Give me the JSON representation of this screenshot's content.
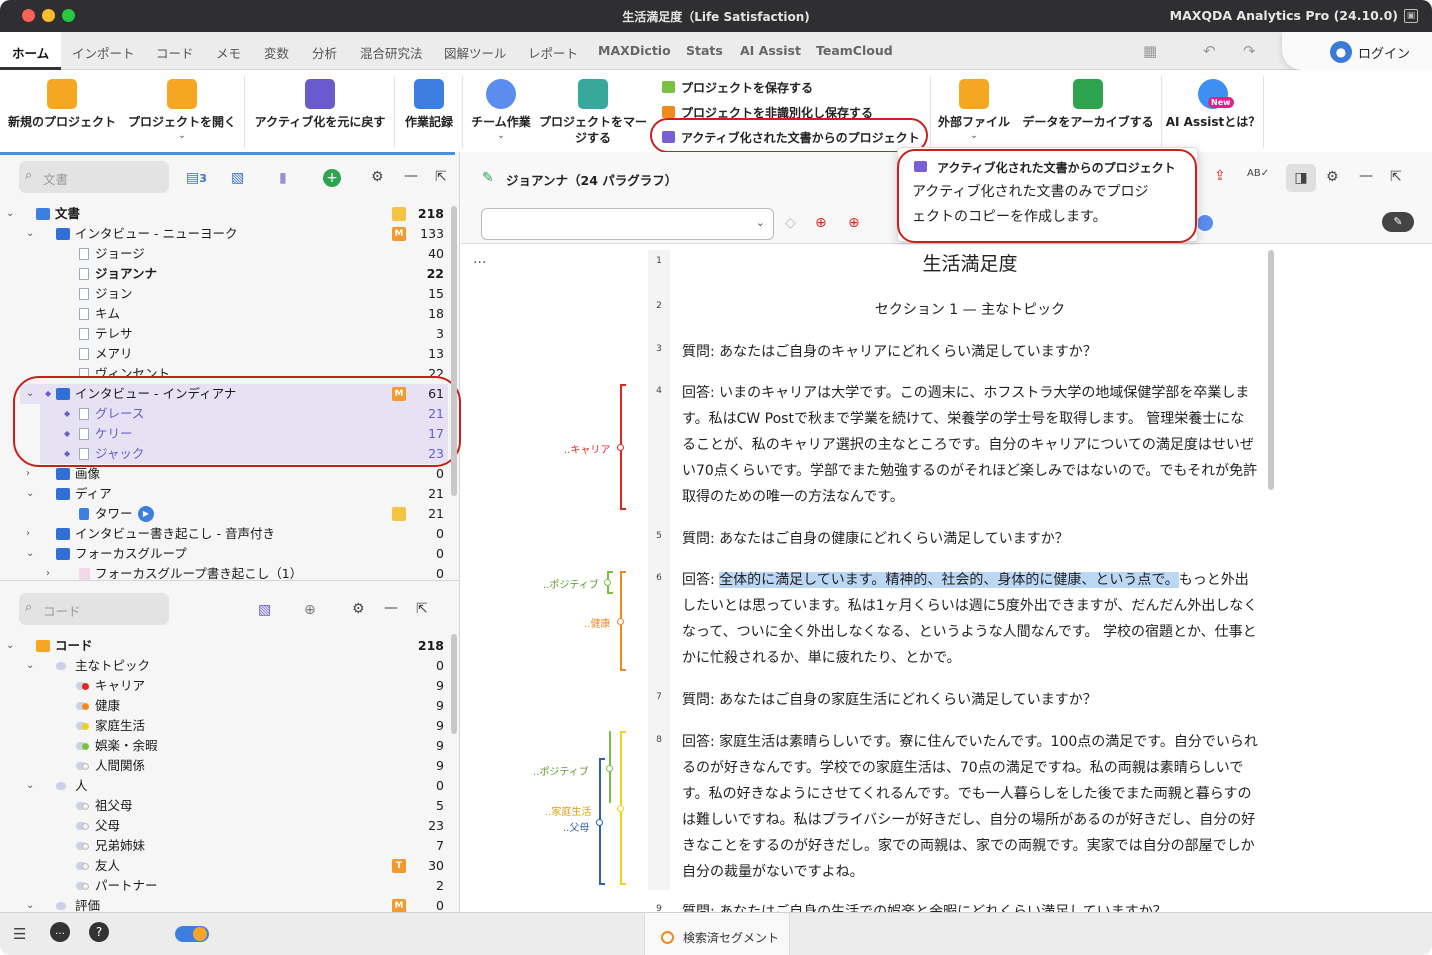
{
  "window": {
    "title": "生活満足度（Life Satisfaction)",
    "app_version": "MAXQDA Analytics Pro (24.10.0)"
  },
  "tabs": [
    "ホーム",
    "インポート",
    "コード",
    "メモ",
    "変数",
    "分析",
    "混合研究法",
    "図解ツール",
    "レポート",
    "MAXDictio",
    "Stats",
    "AI Assist",
    "TeamCloud"
  ],
  "login_label": "ログイン",
  "ribbon": {
    "new_project": "新規のプロジェクト",
    "open_project": "プロジェクトを開く",
    "undo_activation": "アクティブ化を元に戻す",
    "work_log": "作業記録",
    "teamwork": "チーム作業",
    "merge_line1": "プロジェクトをマー",
    "merge_line2": "ジする",
    "save_project": "プロジェクトを保存する",
    "save_anon": "プロジェクトを非識別化し保存する",
    "project_from_active": "アクティブ化された文書からのプロジェクト",
    "external_files": "外部ファイル",
    "archive": "データをアーカイブする",
    "ai_assist": "AI Assistとは？",
    "new_badge": "New"
  },
  "tooltip": {
    "title": "アクティブ化された文書からのプロジェクト",
    "body": "アクティブ化された文書のみでプロジェクトのコピーを作成します。"
  },
  "doc_panel": {
    "search_placeholder": "文書",
    "active_count": "3",
    "rows": [
      {
        "label": "文書",
        "count": "218"
      },
      {
        "label": "インタビュー - ニューヨーク",
        "count": "133",
        "memo": "M"
      },
      {
        "label": "ジョージ",
        "count": "40"
      },
      {
        "label": "ジョアンナ",
        "count": "22"
      },
      {
        "label": "ジョン",
        "count": "15"
      },
      {
        "label": "キム",
        "count": "18"
      },
      {
        "label": "テレサ",
        "count": "3"
      },
      {
        "label": "メアリ",
        "count": "13"
      },
      {
        "label": "ヴィンセント",
        "count": "22"
      },
      {
        "label": "インタビュー - インディアナ",
        "count": "61",
        "memo": "M"
      },
      {
        "label": "グレース",
        "count": "21"
      },
      {
        "label": "ケリー",
        "count": "17"
      },
      {
        "label": "ジャック",
        "count": "23"
      },
      {
        "label": "画像",
        "count": "0"
      },
      {
        "label": "ディア",
        "count": "21"
      },
      {
        "label": "タワー",
        "count": "21"
      },
      {
        "label": "インタビュー書き起こし - 音声付き",
        "count": "0"
      },
      {
        "label": "フォーカスグループ",
        "count": "0"
      },
      {
        "label": "フォーカスグループ書き起こし（1）",
        "count": "0"
      }
    ]
  },
  "code_panel": {
    "search_placeholder": "コード",
    "rows": [
      {
        "label": "コード",
        "count": "218"
      },
      {
        "label": "主なトピック",
        "count": "0"
      },
      {
        "label": "キャリア",
        "count": "9",
        "color": "#e0281f"
      },
      {
        "label": "健康",
        "count": "9",
        "color": "#f08a1c"
      },
      {
        "label": "家庭生活",
        "count": "9",
        "color": "#f2cf18"
      },
      {
        "label": "娯楽・余暇",
        "count": "9",
        "color": "#7bc043"
      },
      {
        "label": "人間関係",
        "count": "9",
        "color": "#f2f2f2"
      },
      {
        "label": "人",
        "count": "0"
      },
      {
        "label": "祖父母",
        "count": "5",
        "color": "#f2f2f2"
      },
      {
        "label": "父母",
        "count": "23",
        "color": "#f2f2f2"
      },
      {
        "label": "兄弟姉妹",
        "count": "7",
        "color": "#f2f2f2"
      },
      {
        "label": "友人",
        "count": "30",
        "color": "#f2f2f2",
        "memo": "T"
      },
      {
        "label": "パートナー",
        "count": "2",
        "color": "#f2f2f2"
      },
      {
        "label": "評価",
        "count": "0",
        "memo": "M"
      }
    ]
  },
  "document": {
    "header": "ジョアンナ（24 パラグラフ）",
    "title": "生活満足度",
    "section": "セクション 1 — 主なトピック",
    "para_numbers": [
      "1",
      "2",
      "3",
      "4",
      "5",
      "6",
      "7",
      "8",
      "9"
    ],
    "q3": "質問: あなたはご自身のキャリアにどれくらい満足していますか？",
    "a4": "回答: いまのキャリアは大学です。この週末に、ホフストラ大学の地域保健学部を卒業します。私はCW Postで秋まで学業を続けて、栄養学の学士号を取得します。 管理栄養士になることが、私のキャリア選択の主なところです。自分のキャリアについての満足度はせいぜい70点くらいです。学部でまた勉強するのがそれほど楽しみではないので。でもそれが免許取得のための唯一の方法なんです。",
    "q5": "質問: あなたはご自身の健康にどれくらい満足していますか？",
    "a6_prefix": "回答: ",
    "a6_highlight": "全体的に満足しています。精神的、社会的、身体的に健康、という点で。",
    "a6_rest": "もっと外出したいとは思っています。私は1ヶ月くらいは週に5度外出できますが、だんだん外出しなくなって、ついに全く外出しなくなる、というような人間なんです。 学校の宿題とか、仕事とかに忙殺されるか、単に疲れたり、とかで。",
    "q7": "質問: あなたはご自身の家庭生活にどれくらい満足していますか？",
    "a8": "回答: 家庭生活は素晴らしいです。寮に住んでいたんです。100点の満足です。自分でいられるのが好きなんです。学校での家庭生活は、70点の満足ですね。私の両親は素晴らしいです。私の好きなようにさせてくれるんです。でも一人暮らしをした後でまた両親と暮らすのは難しいですね。私はプライバシーが好きだし、自分の場所があるのが好きだし、自分の好きなことをするのが好きだし。家での両親は、家での両親です。実家では自分の部屋でしか自分の裁量がないですよね。",
    "q9": "質問: あなたはご自身の生活での娯楽と余暇にどれくらい満足していますか？"
  },
  "code_labels": {
    "career": "..キャリア",
    "positive1": "..ポジティブ",
    "health": "..健康",
    "positive2": "..ポジティブ",
    "family": "..家庭生活",
    "parents": "..父母"
  },
  "footer": {
    "retrieved_segments": "検索済セグメント"
  }
}
